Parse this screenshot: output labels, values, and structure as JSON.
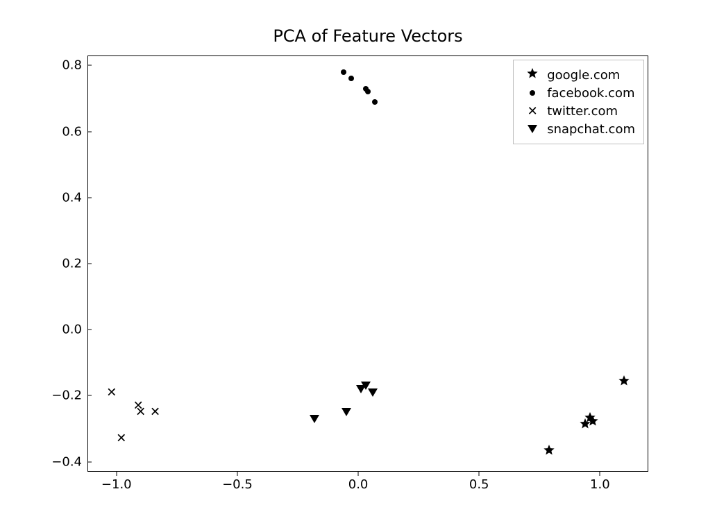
{
  "chart_data": {
    "type": "scatter",
    "title": "PCA of Feature Vectors",
    "xlabel": "",
    "ylabel": "",
    "xlim": [
      -1.12,
      1.2
    ],
    "ylim": [
      -0.43,
      0.83
    ],
    "xticks": [
      -1.0,
      -0.5,
      0.0,
      0.5,
      1.0
    ],
    "yticks": [
      -0.4,
      -0.2,
      0.0,
      0.2,
      0.4,
      0.6,
      0.8
    ],
    "xtick_labels": [
      "−1.0",
      "−0.5",
      "0.0",
      "0.5",
      "1.0"
    ],
    "ytick_labels": [
      "−0.4",
      "−0.2",
      "0.0",
      "0.2",
      "0.4",
      "0.6",
      "0.8"
    ],
    "legend_position": "upper right",
    "series": [
      {
        "name": "google.com",
        "marker": "star",
        "points": [
          {
            "x": 0.96,
            "y": -0.27
          },
          {
            "x": 0.94,
            "y": -0.29
          },
          {
            "x": 0.97,
            "y": -0.28
          },
          {
            "x": 1.1,
            "y": -0.16
          },
          {
            "x": 0.79,
            "y": -0.37
          }
        ]
      },
      {
        "name": "facebook.com",
        "marker": "circle",
        "points": [
          {
            "x": -0.06,
            "y": 0.78
          },
          {
            "x": -0.03,
            "y": 0.76
          },
          {
            "x": 0.03,
            "y": 0.73
          },
          {
            "x": 0.04,
            "y": 0.72
          },
          {
            "x": 0.07,
            "y": 0.69
          }
        ]
      },
      {
        "name": "twitter.com",
        "marker": "x",
        "points": [
          {
            "x": -1.02,
            "y": -0.19
          },
          {
            "x": -0.91,
            "y": -0.23
          },
          {
            "x": -0.9,
            "y": -0.25
          },
          {
            "x": -0.84,
            "y": -0.25
          },
          {
            "x": -0.98,
            "y": -0.33
          }
        ]
      },
      {
        "name": "snapchat.com",
        "marker": "triangle_down",
        "points": [
          {
            "x": 0.01,
            "y": -0.18
          },
          {
            "x": 0.03,
            "y": -0.17
          },
          {
            "x": 0.06,
            "y": -0.19
          },
          {
            "x": -0.05,
            "y": -0.25
          },
          {
            "x": -0.18,
            "y": -0.27
          }
        ]
      }
    ]
  },
  "geometry": {
    "axes_left": 126,
    "axes_top": 80,
    "axes_width": 808,
    "axes_height": 600
  }
}
